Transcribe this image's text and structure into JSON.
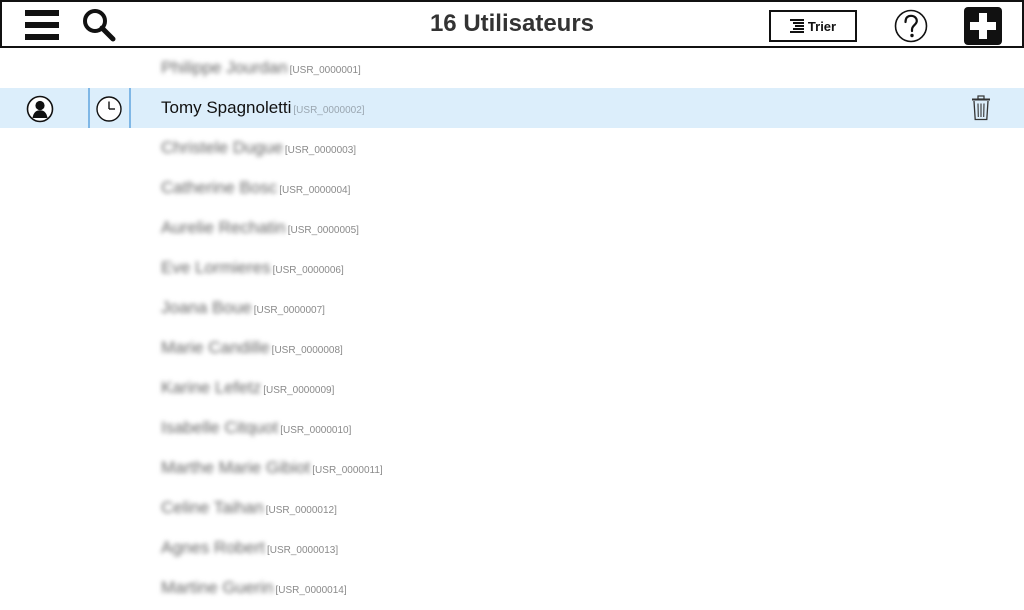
{
  "header": {
    "title": "16 Utilisateurs",
    "sort_label": "Trier",
    "icons": {
      "menu": "hamburger-menu-icon",
      "search": "magnifier-search-icon",
      "sort": "sort-lines-icon",
      "help": "question-circle-icon",
      "add": "plus-square-icon"
    }
  },
  "selected_row_icons": {
    "profile": "user-silhouette-icon",
    "history": "clock-icon",
    "delete": "trash-can-icon"
  },
  "colors": {
    "selected_row_bg": "#dceefb",
    "separator": "#7fb7e6",
    "border": "#111111"
  },
  "users": [
    {
      "name": "Philippe Jourdan",
      "id": "[USR_0000001]",
      "selected": false
    },
    {
      "name": "Tomy Spagnoletti",
      "id": "[USR_0000002]",
      "selected": true
    },
    {
      "name": "Christele Dugue",
      "id": "[USR_0000003]",
      "selected": false
    },
    {
      "name": "Catherine Bosc",
      "id": "[USR_0000004]",
      "selected": false
    },
    {
      "name": "Aurelie Rechatin",
      "id": "[USR_0000005]",
      "selected": false
    },
    {
      "name": "Eve Lormieres",
      "id": "[USR_0000006]",
      "selected": false
    },
    {
      "name": "Joana Boue",
      "id": "[USR_0000007]",
      "selected": false
    },
    {
      "name": "Marie Candille",
      "id": "[USR_0000008]",
      "selected": false
    },
    {
      "name": "Karine Lefetz",
      "id": "[USR_0000009]",
      "selected": false
    },
    {
      "name": "Isabelle Citquot",
      "id": "[USR_0000010]",
      "selected": false
    },
    {
      "name": "Marthe Marie Gibiot",
      "id": "[USR_0000011]",
      "selected": false
    },
    {
      "name": "Celine Taihan",
      "id": "[USR_0000012]",
      "selected": false
    },
    {
      "name": "Agnes Robert",
      "id": "[USR_0000013]",
      "selected": false
    },
    {
      "name": "Martine Guerin",
      "id": "[USR_0000014]",
      "selected": false
    }
  ]
}
